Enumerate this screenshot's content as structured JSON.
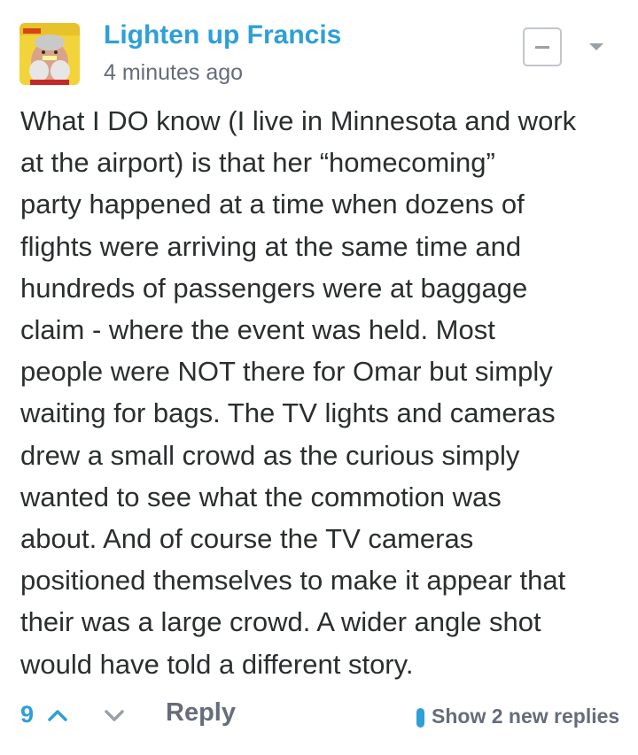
{
  "comment": {
    "author": "Lighten up Francis",
    "timestamp": "4 minutes ago",
    "body_lines": [
      "What I DO know (I live in Minnesota and work",
      "at the airport) is that her “homecoming”",
      "party happened at a time when dozens of",
      "flights were arriving at the same time and",
      "hundreds of passengers were at baggage",
      "claim - where the event was held. Most",
      "people were NOT there for Omar but simply",
      "waiting for bags. The TV lights and cameras",
      "drew a small crowd as the curious simply",
      "wanted to see what the commotion was",
      "about. And of course the TV cameras",
      "positioned themselves to make it appear that",
      "their was a large crowd. A wider angle shot",
      "would have told a different story."
    ],
    "votes": "9",
    "reply_label": "Reply",
    "new_replies_label": "Show 2 new replies"
  },
  "icons": {
    "collapse": "minus-square-icon",
    "menu": "chevron-down-icon",
    "upvote": "chevron-up-icon",
    "downvote": "chevron-down-icon"
  },
  "colors": {
    "accent": "#2e9fd7",
    "text": "#2a2e2e",
    "muted": "#656c7a"
  }
}
